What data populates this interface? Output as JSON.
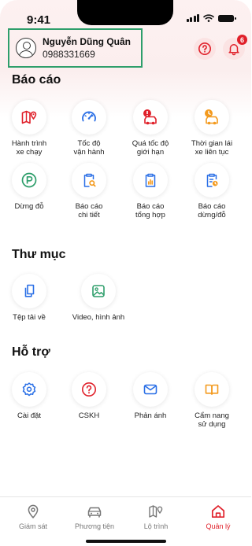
{
  "status_bar": {
    "time": "9:41"
  },
  "user": {
    "name": "Nguyễn Dũng Quân",
    "phone": "0988331669"
  },
  "header": {
    "notification_count": "6"
  },
  "colors": {
    "accent_red": "#e0202a",
    "accent_blue": "#2a6fe6",
    "accent_green": "#2e9e6b",
    "accent_orange": "#f39a1e",
    "card_border": "#2e9e6b"
  },
  "sections": {
    "reports": {
      "title": "Báo cáo",
      "items": [
        {
          "label": "Hành trình\nxe chạy",
          "icon": "map-route-icon"
        },
        {
          "label": "Tốc độ\nvận hành",
          "icon": "speedometer-icon"
        },
        {
          "label": "Quá tốc độ\ngiới hạn",
          "icon": "car-alert-icon"
        },
        {
          "label": "Thời gian lái\nxe liên tục",
          "icon": "car-clock-icon"
        },
        {
          "label": "Dừng đỗ",
          "icon": "parking-icon"
        },
        {
          "label": "Báo cáo\nchi tiết",
          "icon": "clipboard-search-icon"
        },
        {
          "label": "Báo cáo\ntổng hợp",
          "icon": "clipboard-chart-icon"
        },
        {
          "label": "Báo cáo\ndừng/đỗ",
          "icon": "clipboard-clock-icon"
        }
      ]
    },
    "folders": {
      "title": "Thư mục",
      "items": [
        {
          "label": "Tệp tải về",
          "icon": "files-icon"
        },
        {
          "label": "Video, hình ảnh",
          "icon": "image-icon"
        }
      ]
    },
    "support": {
      "title": "Hỗ trợ",
      "items": [
        {
          "label": "Cài đặt",
          "icon": "settings-icon"
        },
        {
          "label": "CSKH",
          "icon": "help-icon"
        },
        {
          "label": "Phản ánh",
          "icon": "mail-icon"
        },
        {
          "label": "Cẩm nang\nsử dụng",
          "icon": "book-icon"
        }
      ]
    }
  },
  "nav": {
    "items": [
      {
        "label": "Giám sát",
        "icon": "location-pin-icon"
      },
      {
        "label": "Phương tiện",
        "icon": "car-icon"
      },
      {
        "label": "Lộ trình",
        "icon": "route-map-icon"
      },
      {
        "label": "Quản lý",
        "icon": "home-icon"
      }
    ],
    "active": "Quản lý"
  }
}
